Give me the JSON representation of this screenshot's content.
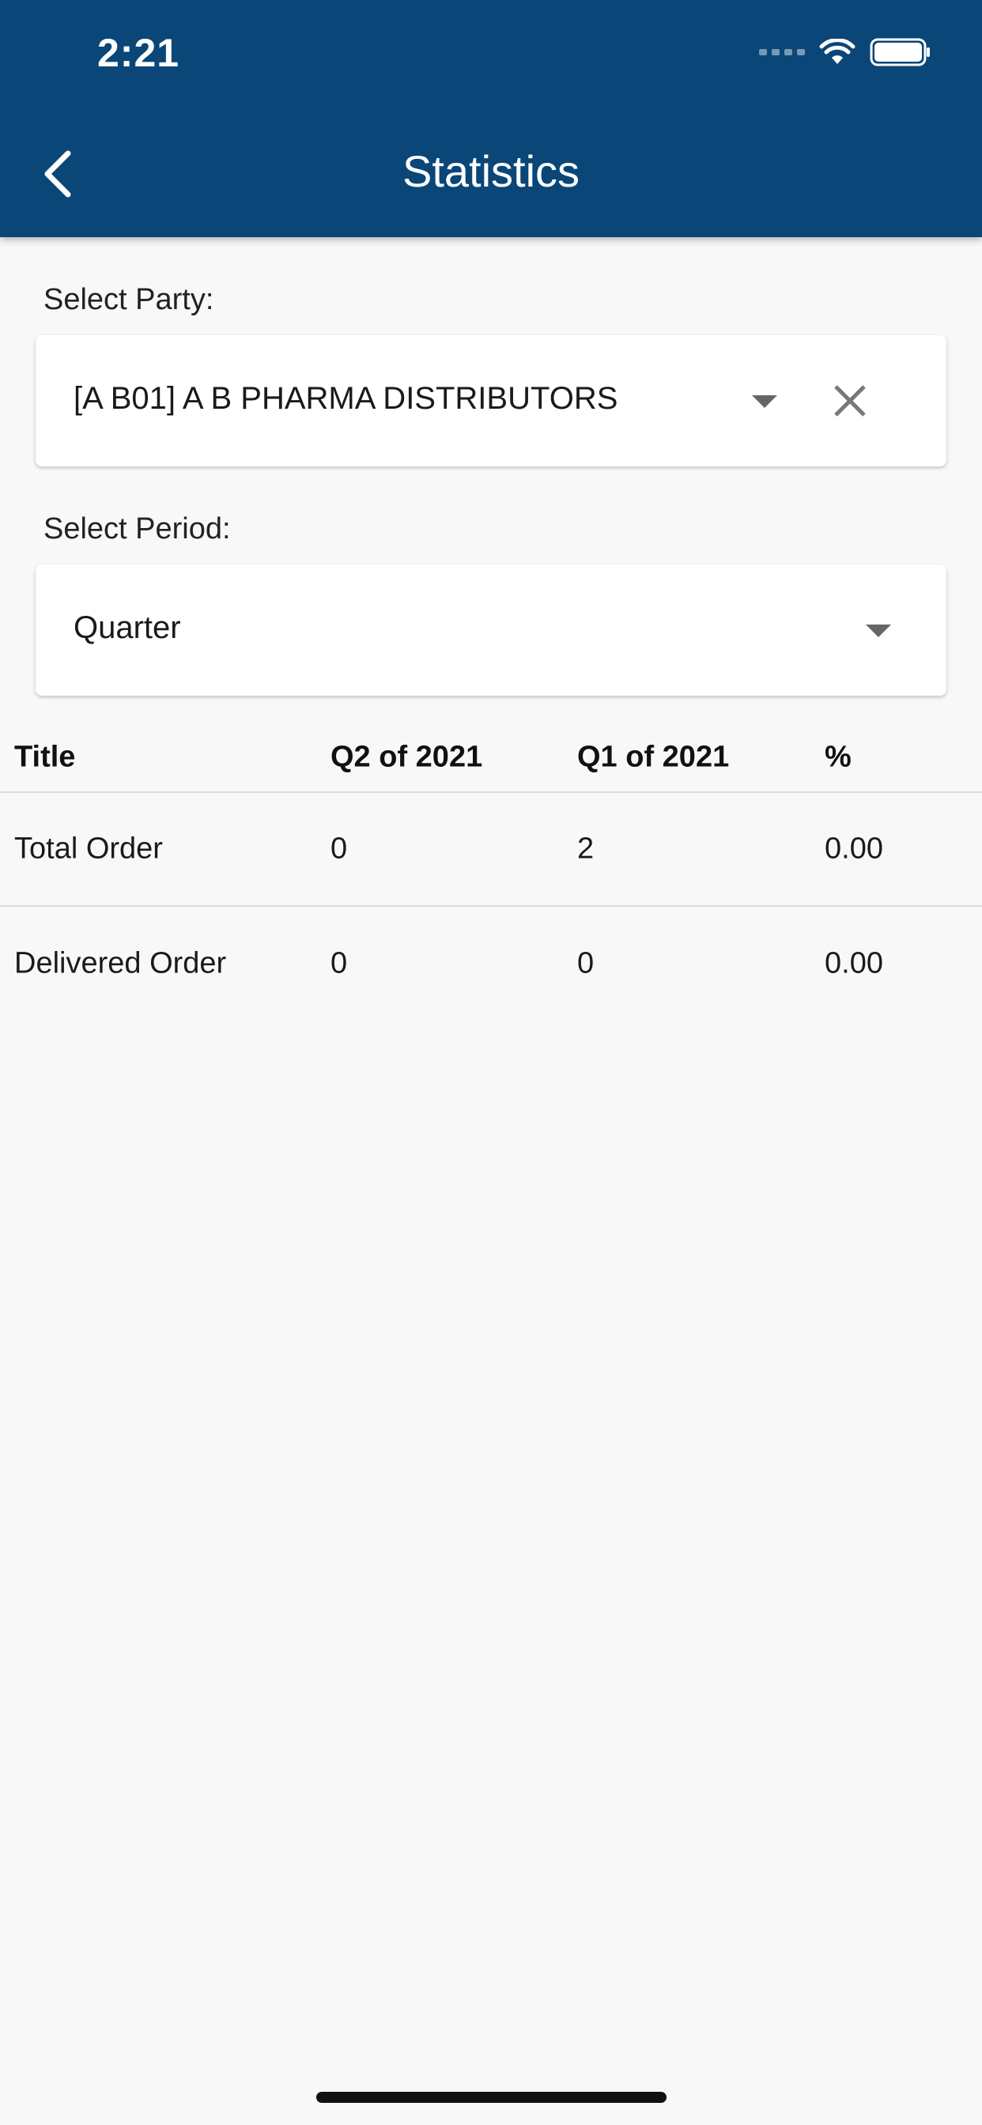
{
  "status_bar": {
    "time": "2:21"
  },
  "header": {
    "title": "Statistics",
    "back_icon": "chevron-left-icon",
    "background_color": "#0a4677"
  },
  "party": {
    "label": "Select Party:",
    "value": "[A B01] A B PHARMA DISTRIBUTORS"
  },
  "period": {
    "label": "Select Period:",
    "value": "Quarter"
  },
  "table": {
    "headers": [
      "Title",
      "Q2 of 2021",
      "Q1 of 2021",
      "%"
    ],
    "rows": [
      [
        "Total Order",
        "0",
        "2",
        "0.00"
      ],
      [
        "Delivered Order",
        "0",
        "0",
        "0.00"
      ]
    ]
  }
}
